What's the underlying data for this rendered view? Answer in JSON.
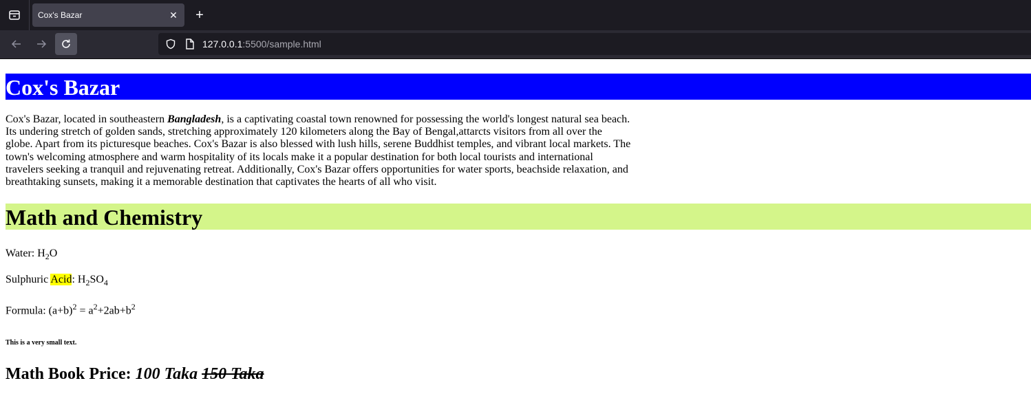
{
  "browser": {
    "tab_title": "Cox's Bazar",
    "close_glyph": "✕",
    "newtab_glyph": "+",
    "url_host": "127.0.0.1",
    "url_path": ":5500/sample.html"
  },
  "content": {
    "heading1": "Cox's Bazar",
    "intro_before": "Cox's Bazar, located in southeastern ",
    "intro_bold": "Bangladesh",
    "intro_after": ", is a captivating coastal town renowned for possessing the world's longest natural sea beach. Its undering stretch of golden sands, stretching approximately 120 kilometers along the Bay of Bengal,attarcts visitors from all over the globe. Apart from its picturesque beaches. Cox's Bazar is also blessed with lush hills, serene Buddhist temples, and vibrant local markets. The town's welcoming atmosphere and warm hospitality of its locals make it a popular destination for both local tourists and international travelers seeking a tranquil and rejuvenating retreat. Additionally, Cox's Bazar offers opportunities for water sports, beachside relaxation, and breathtaking sunsets, making it a memorable destination that captivates the hearts of all who visit.",
    "heading2": "Math and Chemistry",
    "water_label": "Water: H",
    "water_sub": "2",
    "water_rest": "O",
    "acid_label_pre": "Sulphuric ",
    "acid_highlight": "Acid",
    "acid_label_post": ": H",
    "acid_sub1": "2",
    "acid_mid": "SO",
    "acid_sub2": "4",
    "formula_label": "Formula: (a+b)",
    "formula_sup1": "2",
    "formula_mid": " = a",
    "formula_sup2": "2",
    "formula_mid2": "+2ab+b",
    "formula_sup3": "2",
    "small_text": "This is a very small text.",
    "price_label": "Math Book Price: ",
    "price_new": "100 Taka",
    "price_old": "150 Taka"
  },
  "colors": {
    "heading1_bg": "#0000ff",
    "heading2_bg": "#d4f58a",
    "highlight": "#ffff00"
  }
}
